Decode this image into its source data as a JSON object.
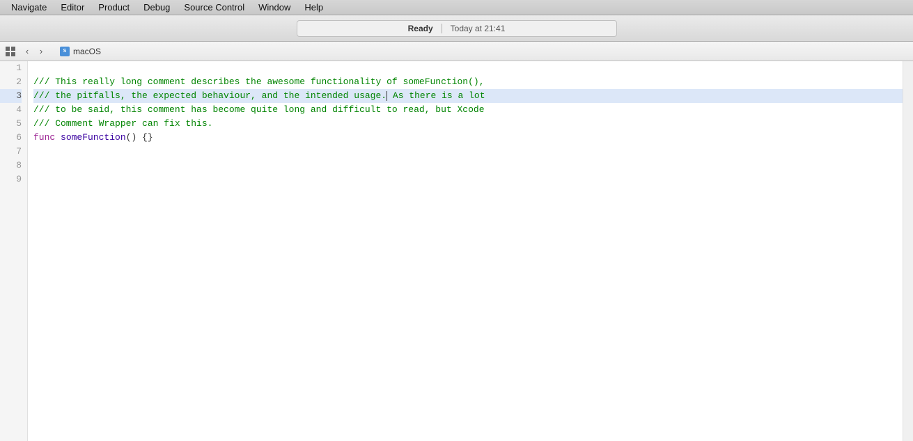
{
  "menubar": {
    "items": [
      {
        "label": "Navigate",
        "id": "navigate"
      },
      {
        "label": "Editor",
        "id": "editor"
      },
      {
        "label": "Product",
        "id": "product"
      },
      {
        "label": "Debug",
        "id": "debug"
      },
      {
        "label": "Source Control",
        "id": "source-control"
      },
      {
        "label": "Window",
        "id": "window"
      },
      {
        "label": "Help",
        "id": "help"
      }
    ]
  },
  "toolbar": {
    "status_ready": "Ready",
    "status_time": "Today at 21:41"
  },
  "tabbar": {
    "file_name": "macOS"
  },
  "editor": {
    "lines": [
      {
        "num": 1,
        "content": "",
        "type": "plain",
        "active": false
      },
      {
        "num": 2,
        "content": "/// This really long comment describes the awesome functionality of someFunction(),",
        "type": "comment",
        "active": false
      },
      {
        "num": 3,
        "content": "/// the pitfalls, the expected behaviour, and the intended usage.| As there is a lot",
        "type": "comment",
        "active": true
      },
      {
        "num": 4,
        "content": "/// to be said, this comment has become quite long and difficult to read, but Xcode",
        "type": "comment",
        "active": false
      },
      {
        "num": 5,
        "content": "/// Comment Wrapper can fix this.",
        "type": "comment",
        "active": false
      },
      {
        "num": 6,
        "content": "func someFunction() {}",
        "type": "func",
        "active": false
      },
      {
        "num": 7,
        "content": "",
        "type": "plain",
        "active": false
      },
      {
        "num": 8,
        "content": "",
        "type": "plain",
        "active": false
      },
      {
        "num": 9,
        "content": "",
        "type": "plain",
        "active": false
      }
    ]
  }
}
